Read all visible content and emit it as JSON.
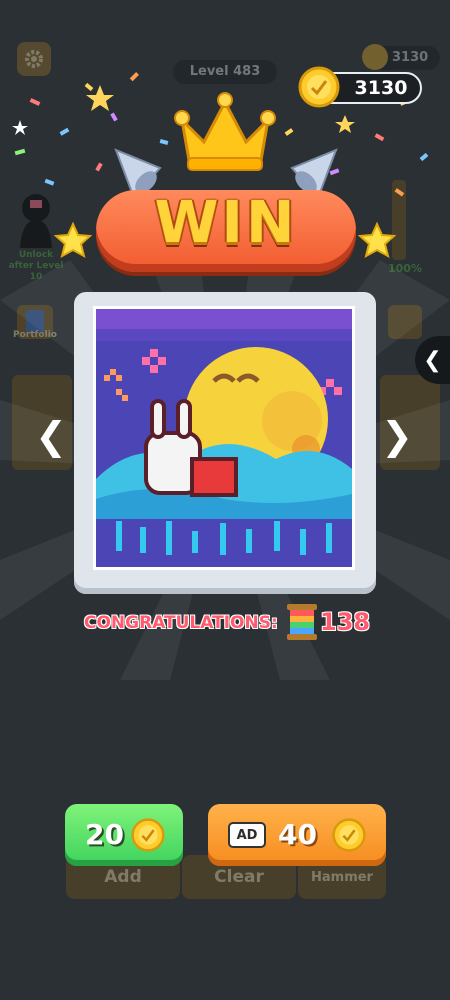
{
  "level_label": "Level 483",
  "background_coins": "3130",
  "coins": "3130",
  "unlock_text": "Unlock after Level 10",
  "progress_text": "100%",
  "portfolio_label": "Portfolio",
  "win_title": "WIN",
  "congrats_label": "CONGRATULATIONS:",
  "reward_value": "138",
  "green_button_value": "20",
  "ad_badge": "AD",
  "orange_button_value": "40",
  "bottom_tools": [
    "Add",
    "Clear",
    "Hammer"
  ],
  "side_tab_glyph": "❮",
  "arrows": {
    "left": "❮",
    "right": "❯"
  },
  "icons": [
    "gear-icon",
    "coin-icon",
    "crown-icon",
    "star-icon",
    "party-popper-icon",
    "thread-spool-icon",
    "ad-video-icon"
  ],
  "colors": {
    "banner": "#f15a2e",
    "win_text": "#ffd43b",
    "green_button": "#3ed25c",
    "orange_button": "#f68b1e",
    "congrats": "#ff5a6e"
  }
}
